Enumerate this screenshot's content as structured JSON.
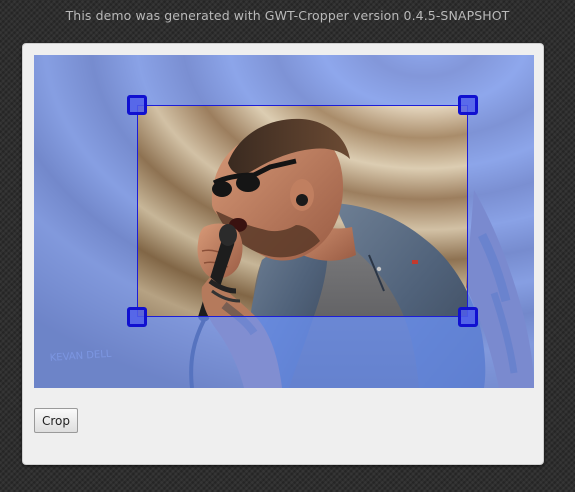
{
  "header": {
    "banner_text": "This demo was generated with GWT-Cropper version 0.4.5-SNAPSHOT"
  },
  "cropper": {
    "image_alt": "Cropping image",
    "watermark_text": "KEVAN DELL",
    "accent_color": "#1c1cd8",
    "handle_color": "#1010d0"
  },
  "actions": {
    "crop_label": "Crop"
  }
}
